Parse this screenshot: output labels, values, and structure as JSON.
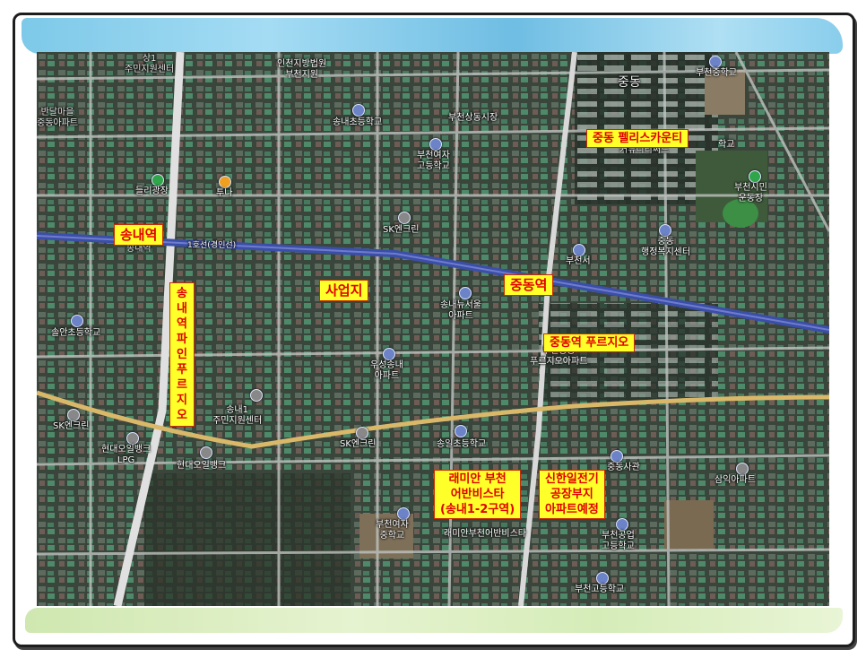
{
  "map": {
    "place_labels": {
      "sang1_center": "상1\n주민지원센터",
      "incheon_court": "인천지방법원\n부천지원",
      "banhamaeul": "반달마을\n중동아파트",
      "songnae_elem": "송내초등학교",
      "bucheon_sangdong_market": "부천상동시장",
      "jungdong": "중동",
      "bucheon_mid_school": "부천중학교",
      "bucheon_girls_high": "부천여자\n고등학교",
      "jungdong_area_school": "학교",
      "jungdong_apt_text": "커뮤니티써드",
      "dolri_plaza": "들리광장",
      "tuna": "투나",
      "bucheon_citizen_stadium": "부천시민\n운동장",
      "sk_enclean_1": "SK엔크린",
      "line1": "1호선(경인선)",
      "jungdong_admin": "중동\n행정복지센터",
      "bucheonseo": "부천서",
      "songnae_station_small": "송내역",
      "songnae_newseoul": "송내뉴서울\n아파트",
      "songan_elem": "솔안초등학교",
      "jungdong_prugio_apt": "부천중동\n푸르지오아파트",
      "woosung_songnae": "우성송내\n아파트",
      "songnae1_center": "송내1\n주민지원센터",
      "sk_enclean_2": "SK엔크린",
      "sk_enclean_3": "SK엔크린",
      "hyundai_oilbank_lpg": "현대오일뱅크\nLPG",
      "hyundai_oilbank": "현대오일뱅크",
      "songil_elem": "송일초등학교",
      "jung_building": "중동사관",
      "samik_apt": "삼익아파트",
      "bucheon_girls_mid": "부천여자\n중학교",
      "raemian_urban_small": "래미안부천어반비스타",
      "bucheon_tech_high": "부천공업\n고등학교",
      "bucheon_high": "부천고등학교"
    },
    "callouts": {
      "songnae_station": "송내역",
      "saeopji": "사업지",
      "jungdong_station": "중동역",
      "jungdong_palace": "중동 펠리스카운티",
      "songnae_prugio": "송\n내\n역\n파\n인\n푸\n르\n지\n오",
      "jungdong_prugio": "중동역 푸르지오",
      "raemian": "래미안 부천\n어반비스타\n(송내1-2구역)",
      "shinhan": "신한일전기\n공장부지\n아파트예정"
    },
    "colors": {
      "callout_bg": "#ffff2a",
      "callout_text": "#e00000",
      "rail": "#3b4fa8",
      "road": "#d9b86a"
    }
  }
}
